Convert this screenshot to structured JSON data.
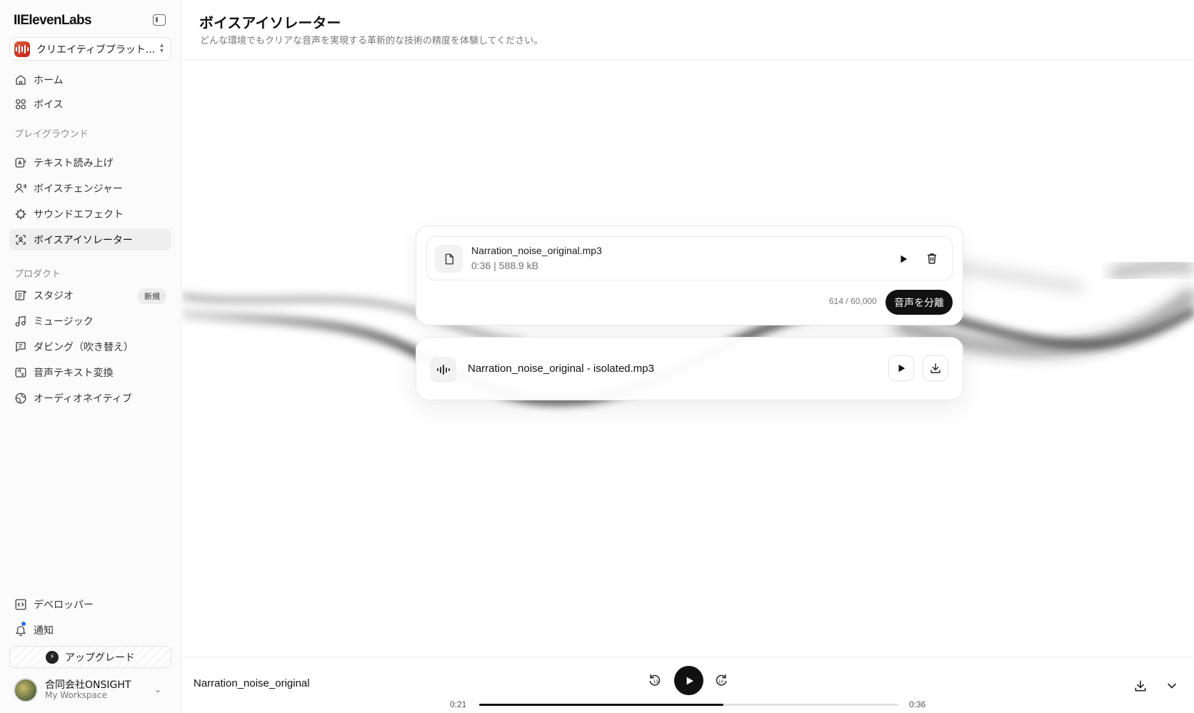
{
  "app": {
    "logo": "IIElevenLabs"
  },
  "workspace_select": {
    "label": "クリエイティブプラット..."
  },
  "nav": {
    "home": "ホーム",
    "voices": "ボイス",
    "playground_label": "プレイグラウンド",
    "tts": "テキスト読み上げ",
    "voice_changer": "ボイスチェンジャー",
    "sound_effects": "サウンドエフェクト",
    "voice_isolator": "ボイスアイソレーター",
    "products_label": "プロダクト",
    "studio": "スタジオ",
    "studio_badge": "新規",
    "music": "ミュージック",
    "dubbing": "ダビング（吹き替え）",
    "speech_to_text": "音声テキスト変換",
    "audio_native": "オーディオネイティブ",
    "developers": "デベロッパー",
    "notifications": "通知"
  },
  "upgrade": {
    "label": "アップグレード"
  },
  "account": {
    "name": "合同会社ONSIGHT",
    "workspace": "My Workspace"
  },
  "header": {
    "title": "ボイスアイソレーター",
    "subtitle": "どんな環境でもクリアな音声を実現する革新的な技術の精度を体験してください。"
  },
  "upload": {
    "file_name": "Narration_noise_original.mp3",
    "file_meta": "0:36 | 588.9 kB",
    "char_count": "614 / 60,000",
    "isolate_button": "音声を分離"
  },
  "result": {
    "file_name": "Narration_noise_original - isolated.mp3"
  },
  "player": {
    "title": "Narration_noise_original",
    "current_time": "0:21",
    "total_time": "0:36",
    "progress_fraction": 0.583
  },
  "colors": {
    "accent": "#111111",
    "brand_icon": "#c8321f",
    "notification_dot": "#2f6fe8"
  },
  "icons": {
    "collapse": "sidebar-collapse-icon",
    "home": "home-icon",
    "voices": "grid-icon",
    "tts": "text-speech-icon",
    "voice_changer": "voice-changer-icon",
    "sound_effects": "sparkle-icon",
    "voice_isolator": "isolator-icon",
    "studio": "studio-icon",
    "music": "music-note-icon",
    "dubbing": "dubbing-icon",
    "speech_to_text": "speech-to-text-icon",
    "audio_native": "globe-icon",
    "developers": "code-icon",
    "notifications": "bell-icon"
  }
}
